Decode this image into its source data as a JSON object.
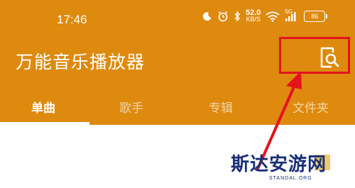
{
  "status_bar": {
    "time": "17:46",
    "net_speed_value": "52.0",
    "net_speed_unit": "KB/S",
    "signal_label": "5G",
    "battery_level": "86"
  },
  "app": {
    "title": "万能音乐播放器"
  },
  "tabs": [
    {
      "label": "单曲",
      "active": true
    },
    {
      "label": "歌手",
      "active": false
    },
    {
      "label": "专辑",
      "active": false
    },
    {
      "label": "文件夹",
      "active": false
    }
  ],
  "watermark": {
    "text": "斯达安游网",
    "sub": "STANDAL.ORG"
  },
  "colors": {
    "header": "#dd8a0f",
    "highlight": "#e5131d",
    "tab_inactive": "#f3d6a6"
  },
  "icons": {
    "search": "search-document-icon",
    "alarm": "alarm-icon",
    "bluetooth": "bluetooth-icon",
    "wifi": "wifi-icon",
    "signal": "signal-icon",
    "battery": "battery-icon",
    "moon": "moon-icon"
  }
}
